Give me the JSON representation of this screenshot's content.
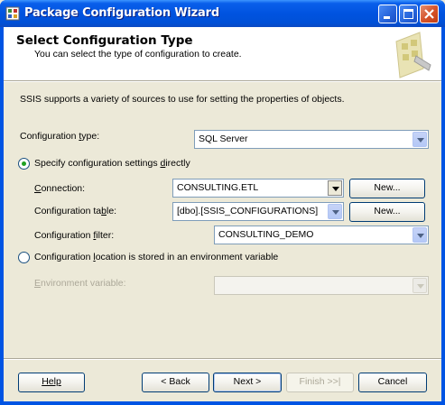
{
  "window": {
    "title": "Package Configuration Wizard"
  },
  "header": {
    "title": "Select Configuration Type",
    "subtitle": "You can select the type of configuration to create."
  },
  "intro": "SSIS supports a variety of sources to use for setting the properties of objects.",
  "config_type": {
    "label_pre": "Configuration ",
    "label_acc": "t",
    "label_post": "ype:",
    "value": "SQL Server"
  },
  "radio_direct": {
    "label_pre": "Specify configuration settings ",
    "label_acc": "d",
    "label_post": "irectly",
    "selected": true
  },
  "connection": {
    "label_pre": "",
    "label_acc": "C",
    "label_post": "onnection:",
    "value": "CONSULTING.ETL",
    "new_label": "New..."
  },
  "config_table": {
    "label_pre": "Configuration ta",
    "label_acc": "b",
    "label_post": "le:",
    "value": "[dbo].[SSIS_CONFIGURATIONS]",
    "new_label": "New..."
  },
  "config_filter": {
    "label_pre": "Configuration ",
    "label_acc": "f",
    "label_post": "ilter:",
    "value": "CONSULTING_DEMO"
  },
  "radio_env": {
    "label_pre": "Configuration ",
    "label_acc": "l",
    "label_post": "ocation is stored in an environment variable",
    "selected": false
  },
  "env_variable": {
    "label_pre": "",
    "label_acc": "E",
    "label_post": "nvironment variable:",
    "value": ""
  },
  "footer": {
    "help": "Help",
    "back": "< Back",
    "next": "Next >",
    "finish": "Finish >>|",
    "cancel": "Cancel"
  }
}
